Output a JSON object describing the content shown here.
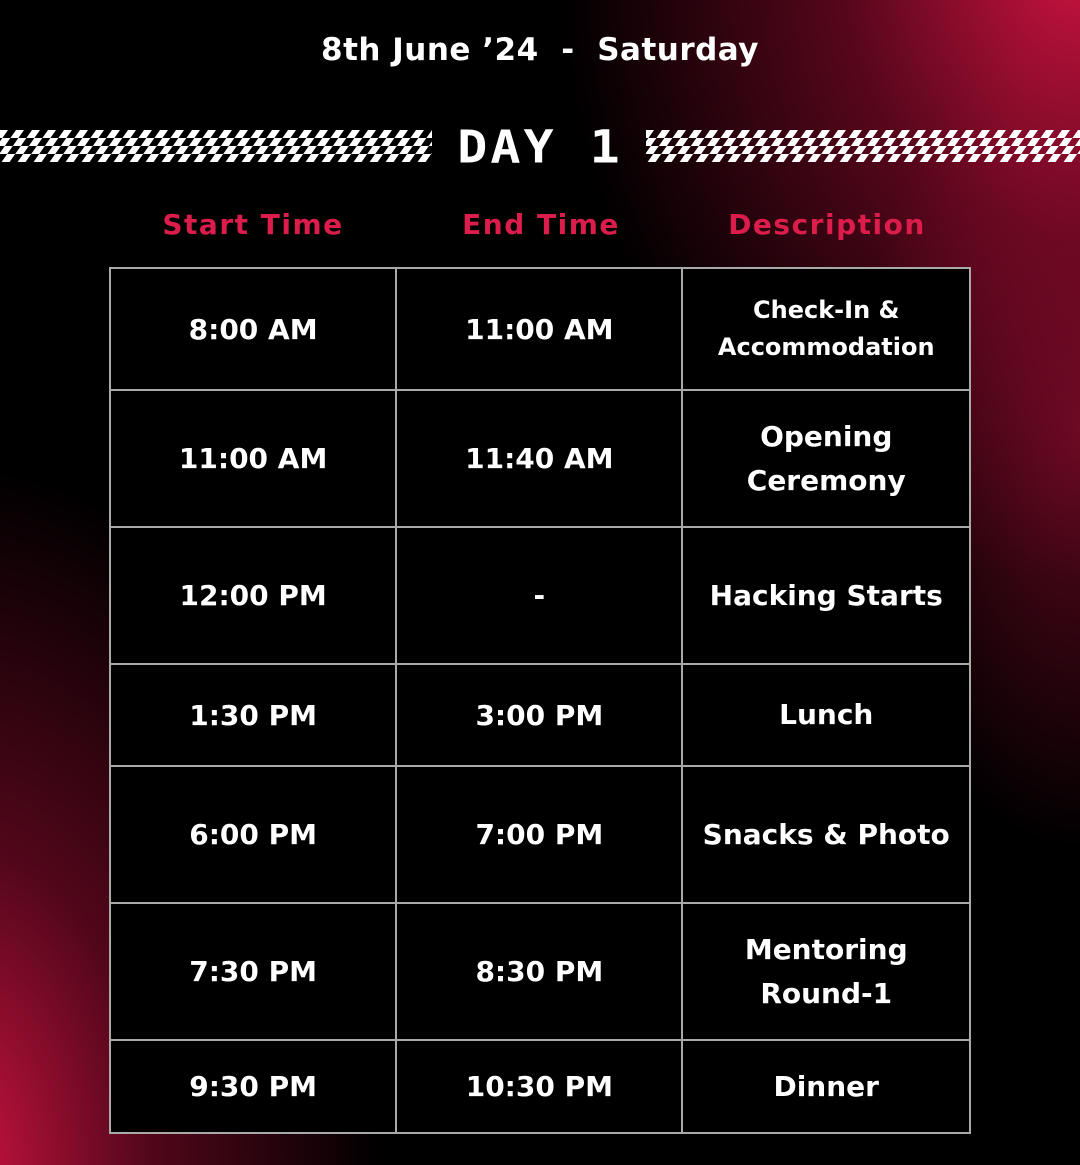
{
  "header": {
    "date": "8th June ’24  -  Saturday",
    "day_title": "DAY 1"
  },
  "columns": [
    "Start Time",
    "End Time",
    "Description"
  ],
  "colors": {
    "accent": "#dc1c4a",
    "background": "#000000",
    "gradient": "#d61444",
    "border": "#a9a9a9",
    "text": "#ffffff"
  },
  "schedule": [
    {
      "start": "8:00 AM",
      "end": "11:00 AM",
      "description": "Check-In & Accommodation"
    },
    {
      "start": "11:00 AM",
      "end": "11:40 AM",
      "description": "Opening Ceremony"
    },
    {
      "start": "12:00 PM",
      "end": "-",
      "description": "Hacking Starts"
    },
    {
      "start": "1:30 PM",
      "end": "3:00 PM",
      "description": "Lunch"
    },
    {
      "start": "6:00 PM",
      "end": "7:00 PM",
      "description": "Snacks & Photo"
    },
    {
      "start": "7:30 PM",
      "end": "8:30 PM",
      "description": "Mentoring Round-1"
    },
    {
      "start": "9:30 PM",
      "end": "10:30 PM",
      "description": "Dinner"
    }
  ]
}
